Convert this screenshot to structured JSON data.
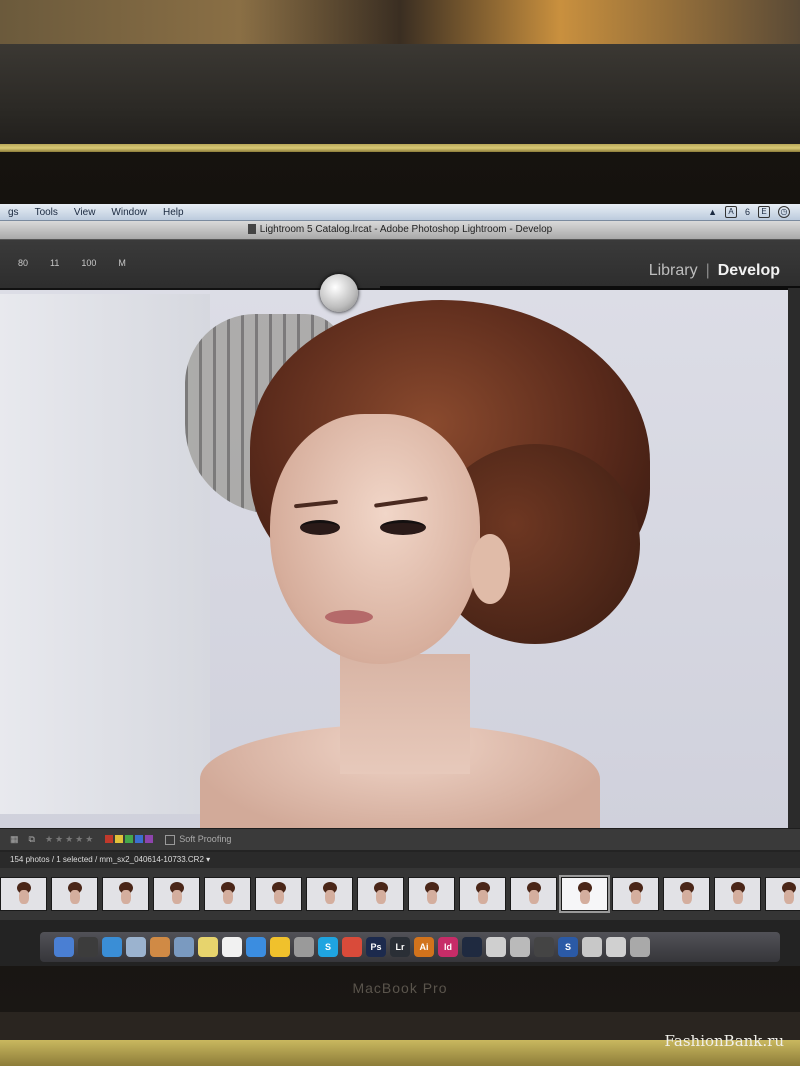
{
  "mac_menubar": {
    "items": [
      "gs",
      "Tools",
      "View",
      "Window",
      "Help"
    ],
    "tray_badge": "6"
  },
  "window": {
    "title": "Lightroom 5 Catalog.lrcat - Adobe Photoshop Lightroom - Develop"
  },
  "lightroom": {
    "modules": [
      "Library",
      "Develop"
    ],
    "active_module": "Develop",
    "histogram_readout": [
      "80",
      "11",
      "100",
      "M"
    ]
  },
  "toolbar": {
    "soft_proofing_label": "Soft Proofing",
    "color_labels": [
      "#c0392b",
      "#e1c13a",
      "#45a84b",
      "#3b6fd1",
      "#8e44ad"
    ]
  },
  "filmstrip": {
    "info": "154 photos / 1 selected / mm_sx2_040614-10733.CR2 ▾",
    "thumbnail_count": 17,
    "selected_index": 11
  },
  "dock": {
    "apps": [
      {
        "name": "finder",
        "label": "",
        "color": "#4a7fd3"
      },
      {
        "name": "dashboard",
        "label": "",
        "color": "#3c3c3c"
      },
      {
        "name": "safari",
        "label": "",
        "color": "#3a8ed6"
      },
      {
        "name": "mail",
        "label": "",
        "color": "#9bb3cf"
      },
      {
        "name": "photos",
        "label": "",
        "color": "#d08a45"
      },
      {
        "name": "itunes",
        "label": "",
        "color": "#7a9ac0"
      },
      {
        "name": "notes",
        "label": "",
        "color": "#e7d46d"
      },
      {
        "name": "textedit",
        "label": "",
        "color": "#f1f1f1"
      },
      {
        "name": "app-store",
        "label": "",
        "color": "#3b8de0"
      },
      {
        "name": "chrome",
        "label": "",
        "color": "#f0c12c"
      },
      {
        "name": "system-prefs",
        "label": "",
        "color": "#9a9a9a"
      },
      {
        "name": "skype",
        "label": "S",
        "color": "#1fa4e0"
      },
      {
        "name": "chrome-2",
        "label": "",
        "color": "#d94b3a"
      },
      {
        "name": "photoshop",
        "label": "Ps",
        "color": "#1c2a4d"
      },
      {
        "name": "lightroom",
        "label": "Lr",
        "color": "#2a2f36"
      },
      {
        "name": "illustrator",
        "label": "Ai",
        "color": "#d2731c"
      },
      {
        "name": "indesign",
        "label": "Id",
        "color": "#c72c68"
      },
      {
        "name": "qt",
        "label": "",
        "color": "#1f2a40"
      },
      {
        "name": "preview",
        "label": "",
        "color": "#cfcfcf"
      },
      {
        "name": "automator",
        "label": "",
        "color": "#bababa"
      },
      {
        "name": "terminal",
        "label": "",
        "color": "#444"
      },
      {
        "name": "s-app",
        "label": "S",
        "color": "#2b5aa6"
      },
      {
        "name": "downloads",
        "label": "",
        "color": "#c8c8c8"
      },
      {
        "name": "documents",
        "label": "",
        "color": "#d0d0d0"
      },
      {
        "name": "trash",
        "label": "",
        "color": "#a9a9a9"
      }
    ]
  },
  "device": {
    "brand": "MacBook Pro"
  },
  "watermark": "FashionBank.ru"
}
